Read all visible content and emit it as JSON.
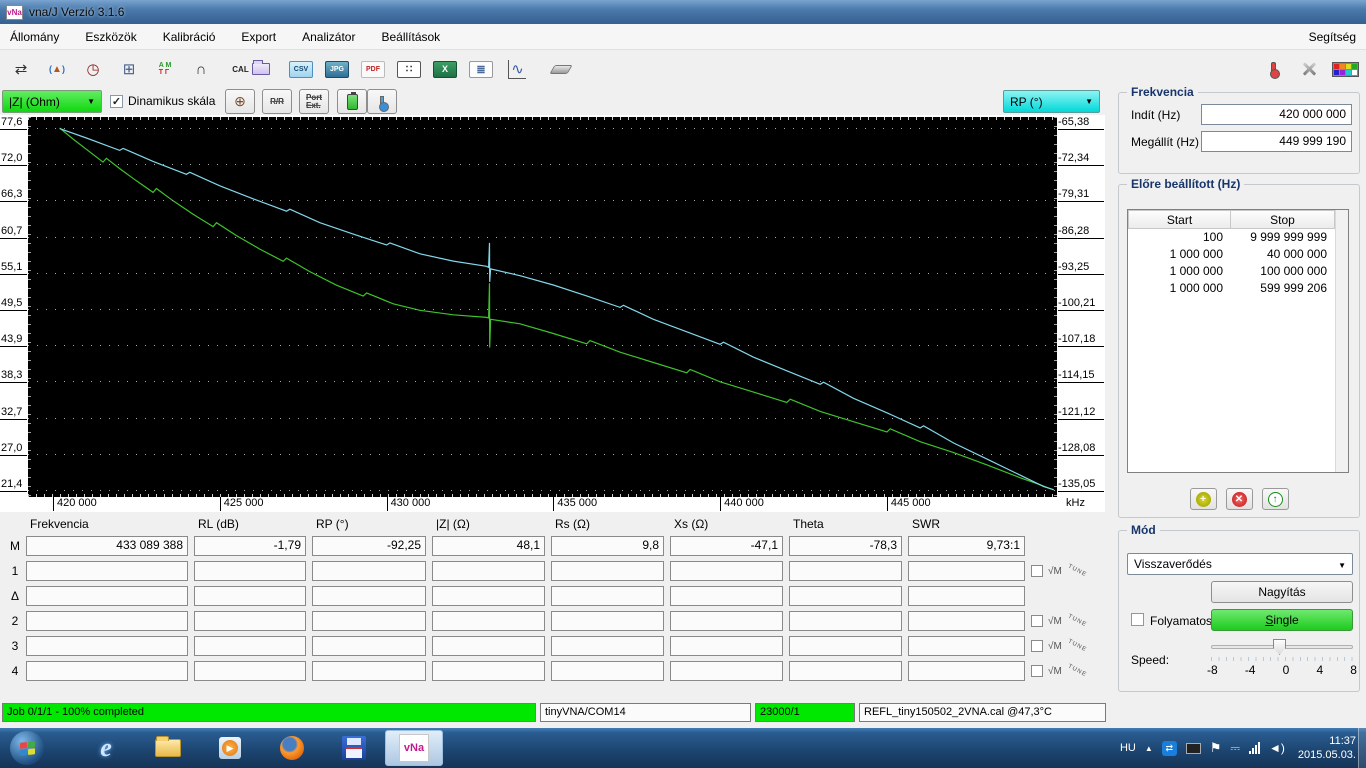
{
  "window": {
    "title": "vna/J Verzió 3.1.6",
    "logo_text": "vNa"
  },
  "menubar": {
    "items": [
      "Állomány",
      "Eszközök",
      "Kalibráció",
      "Export",
      "Analizátor",
      "Beállítások"
    ],
    "help": "Segítség"
  },
  "toolbar": {
    "cal_label": "CAL",
    "csv_label": "CSV",
    "jpg_label": "JPG",
    "pdf_label": "PDF",
    "xls_label": "X",
    "doc_label": "≣",
    "dots_label": "∷",
    "mt_top": "A M",
    "mt_bottom": "T Γ"
  },
  "chartbar": {
    "left_scale": "|Z| (Ohm)",
    "dynamic_scale_label": "Dinamikus skála",
    "dynamic_scale_checked": "✓",
    "right_scale": "RP (°)",
    "rr_button": "R/R",
    "portext_button_line1": "Port",
    "portext_button_line2": "Ext.",
    "smith_glyph": "⊕"
  },
  "chart_data": {
    "type": "line",
    "title": "",
    "xlabel": "kHz",
    "x_range": [
      419250,
      450100
    ],
    "x_ticks": [
      420000,
      425000,
      430000,
      435000,
      440000,
      445000
    ],
    "x_tick_labels": [
      "420 000",
      "425 000",
      "430 000",
      "435 000",
      "440 000",
      "445 000"
    ],
    "grid": "dotted-horizontal",
    "left_axis": {
      "label": "|Z| (Ohm)",
      "color": "#3ec32a",
      "range": [
        21.4,
        77.6
      ],
      "ticks": [
        "77,6",
        "72,0",
        "66,3",
        "60,7",
        "55,1",
        "49,5",
        "43,9",
        "38,3",
        "32,7",
        "27,0",
        "21,4"
      ]
    },
    "right_axis": {
      "label": "RP (°)",
      "color": "#82d7ea",
      "range": [
        -135.05,
        -65.38
      ],
      "ticks": [
        "-65,38",
        "-72,34",
        "-79,31",
        "-86,28",
        "-93,25",
        "-100,21",
        "-107,18",
        "-114,15",
        "-121,12",
        "-128,08",
        "-135,05"
      ]
    },
    "series": [
      {
        "name": "|Z| (Ohm)",
        "axis": "left",
        "color": "#3ec32a",
        "points": [
          [
            420200,
            77.6
          ],
          [
            420600,
            75.9
          ],
          [
            421000,
            74.3
          ],
          [
            421500,
            72.3
          ],
          [
            421600,
            72.9
          ],
          [
            422000,
            71.3
          ],
          [
            422500,
            69.4
          ],
          [
            423000,
            67.6
          ],
          [
            423100,
            68.2
          ],
          [
            423600,
            66.3
          ],
          [
            424200,
            64.2
          ],
          [
            424800,
            62.3
          ],
          [
            424900,
            62.9
          ],
          [
            425500,
            60.9
          ],
          [
            426200,
            58.8
          ],
          [
            426900,
            56.9
          ],
          [
            427000,
            57.4
          ],
          [
            427700,
            55.3
          ],
          [
            428500,
            53.2
          ],
          [
            429300,
            51.5
          ],
          [
            429400,
            52.0
          ],
          [
            430200,
            50.3
          ],
          [
            431000,
            49.3
          ],
          [
            432000,
            48.6
          ],
          [
            433000,
            48.2
          ],
          [
            433060,
            48.1
          ],
          [
            433085,
            53.5
          ],
          [
            433092,
            43.5
          ],
          [
            433120,
            47.9
          ],
          [
            434000,
            47.2
          ],
          [
            435000,
            45.7
          ],
          [
            436000,
            44.1
          ],
          [
            436100,
            44.6
          ],
          [
            437000,
            42.8
          ],
          [
            438000,
            41.2
          ],
          [
            439000,
            39.6
          ],
          [
            439100,
            40.1
          ],
          [
            440000,
            38.2
          ],
          [
            441000,
            36.6
          ],
          [
            442000,
            35.0
          ],
          [
            442100,
            35.5
          ],
          [
            443000,
            33.6
          ],
          [
            444000,
            32.0
          ],
          [
            445000,
            30.4
          ],
          [
            445100,
            30.9
          ],
          [
            446000,
            28.9
          ],
          [
            447000,
            27.2
          ],
          [
            448000,
            25.3
          ],
          [
            449000,
            23.3
          ],
          [
            449600,
            22.2
          ],
          [
            450000,
            21.4
          ]
        ]
      },
      {
        "name": "RP (°)",
        "axis": "right",
        "color": "#82d7ea",
        "points": [
          [
            420200,
            -65.5
          ],
          [
            421000,
            -67.3
          ],
          [
            422000,
            -69.7
          ],
          [
            422100,
            -69.3
          ],
          [
            423000,
            -71.8
          ],
          [
            424000,
            -74.3
          ],
          [
            424100,
            -73.9
          ],
          [
            425000,
            -76.5
          ],
          [
            426000,
            -79.0
          ],
          [
            427000,
            -81.4
          ],
          [
            427100,
            -81.0
          ],
          [
            428000,
            -83.6
          ],
          [
            429000,
            -85.8
          ],
          [
            430000,
            -87.9
          ],
          [
            430100,
            -87.5
          ],
          [
            431000,
            -89.6
          ],
          [
            432000,
            -91.0
          ],
          [
            433000,
            -92.0
          ],
          [
            433060,
            -92.2
          ],
          [
            433085,
            -87.5
          ],
          [
            433092,
            -95.0
          ],
          [
            433120,
            -92.5
          ],
          [
            434000,
            -93.8
          ],
          [
            435000,
            -95.6
          ],
          [
            436000,
            -97.7
          ],
          [
            437000,
            -99.9
          ],
          [
            437100,
            -99.5
          ],
          [
            438000,
            -102.2
          ],
          [
            439000,
            -104.6
          ],
          [
            440000,
            -107.0
          ],
          [
            440100,
            -106.6
          ],
          [
            441000,
            -109.5
          ],
          [
            442000,
            -112.1
          ],
          [
            443000,
            -114.7
          ],
          [
            443100,
            -114.3
          ],
          [
            444000,
            -117.4
          ],
          [
            445000,
            -120.2
          ],
          [
            446000,
            -123.1
          ],
          [
            446100,
            -122.7
          ],
          [
            447000,
            -126.0
          ],
          [
            448000,
            -129.1
          ],
          [
            449000,
            -132.2
          ],
          [
            449700,
            -134.4
          ],
          [
            450000,
            -135.0
          ]
        ]
      }
    ]
  },
  "markers": {
    "headers": [
      "Frekvencia",
      "RL (dB)",
      "RP (°)",
      "|Z| (Ω)",
      "Rs (Ω)",
      "Xs (Ω)",
      "Theta",
      "SWR"
    ],
    "sqrt_m_label": "√M",
    "tune_label": "TUNE",
    "rows": [
      {
        "label": "M",
        "values": [
          "433 089 388",
          "-1,79",
          "-92,25",
          "48,1",
          "9,8",
          "-47,1",
          "-78,3",
          "9,73:1"
        ],
        "tools": false
      },
      {
        "label": "1",
        "values": [
          "",
          "",
          "",
          "",
          "",
          "",
          "",
          ""
        ],
        "tools": true
      },
      {
        "label": "Δ",
        "values": [
          "",
          "",
          "",
          "",
          "",
          "",
          "",
          ""
        ],
        "tools": false
      },
      {
        "label": "2",
        "values": [
          "",
          "",
          "",
          "",
          "",
          "",
          "",
          ""
        ],
        "tools": true
      },
      {
        "label": "3",
        "values": [
          "",
          "",
          "",
          "",
          "",
          "",
          "",
          ""
        ],
        "tools": true
      },
      {
        "label": "4",
        "values": [
          "",
          "",
          "",
          "",
          "",
          "",
          "",
          ""
        ],
        "tools": true
      }
    ]
  },
  "statusbar": {
    "job": "Job 0/1/1 - 100% completed",
    "device": "tinyVNA/COM14",
    "counter": "23000/1",
    "cal_file": "REFL_tiny150502_2VNA.cal @47,3°C"
  },
  "right_panel": {
    "frequency": {
      "title": "Frekvencia",
      "start_label": "Indít (Hz)",
      "start_value": "420 000 000",
      "stop_label": "Megállít (Hz)",
      "stop_value": "449 999 190"
    },
    "presets": {
      "title": "Előre beállított (Hz)",
      "columns": [
        "Start",
        "Stop"
      ],
      "rows": [
        [
          "100",
          "9 999 999 999"
        ],
        [
          "1 000 000",
          "40 000 000"
        ],
        [
          "1 000 000",
          "100 000 000"
        ],
        [
          "1 000 000",
          "599 999 206"
        ]
      ]
    },
    "mode": {
      "title": "Mód",
      "selected": "Visszaverődés",
      "zoom_button": "Nagyítás",
      "continuous_label": "Folyamatos",
      "single_button": "Single",
      "speed_label": "Speed:",
      "speed_ticks": [
        "-8",
        "-4",
        "0",
        "4",
        "8"
      ]
    }
  },
  "taskbar": {
    "language": "HU",
    "time": "11:37",
    "date": "2015.05.03."
  }
}
